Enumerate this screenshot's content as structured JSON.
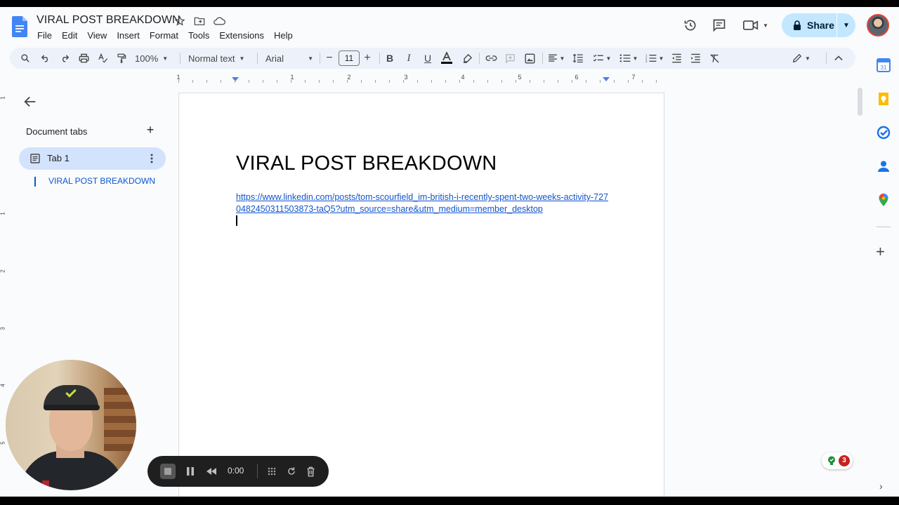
{
  "document": {
    "title": "VIRAL POST BREAKDOWN",
    "heading": "VIRAL POST BREAKDOWN",
    "link_line1": "https://www.linkedin.com/posts/tom-scourfield_im-british-i-recently-spent-two-weeks-activity-727",
    "link_line2": "0482450311503873-taQ5?utm_source=share&utm_medium=member_desktop"
  },
  "menu": [
    "File",
    "Edit",
    "View",
    "Insert",
    "Format",
    "Tools",
    "Extensions",
    "Help"
  ],
  "share": {
    "label": "Share"
  },
  "toolbar": {
    "zoom": "100%",
    "style": "Normal text",
    "font": "Arial",
    "font_size": "11"
  },
  "ruler": {
    "numbers": [
      "1",
      "1",
      "2",
      "3",
      "4",
      "5",
      "6",
      "7"
    ]
  },
  "vruler": {
    "numbers": [
      "1",
      "1",
      "2",
      "3",
      "4",
      "5"
    ]
  },
  "sidebar": {
    "header": "Document tabs",
    "tab_label": "Tab 1",
    "outline_item": "VIRAL POST BREAKDOWN"
  },
  "grammar": {
    "count": "3"
  },
  "recorder": {
    "time": "0:00"
  },
  "colors": {
    "accent": "#0b57d0",
    "share_bg": "#c2e7ff",
    "tab_bg": "#d3e3fd",
    "link": "#1155cc"
  }
}
